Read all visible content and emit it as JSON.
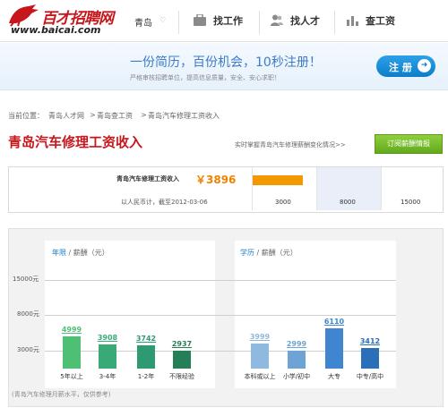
{
  "header": {
    "logo_text": "百才招聘网",
    "logo_url": "www.baicai.com",
    "city": "青岛",
    "nav": [
      {
        "label": "找工作",
        "icon": "briefcase-icon"
      },
      {
        "label": "找人才",
        "icon": "people-icon"
      },
      {
        "label": "查工资",
        "icon": "bar-chart-icon"
      }
    ]
  },
  "banner": {
    "headline": "一份简历，百份机会，10秒注册！",
    "subline": "严格审核招聘单位，提高信息质量，安全、安心求职！",
    "register_label": "注 册"
  },
  "breadcrumb": {
    "prefix": "当前位置：",
    "items": [
      "青岛人才网",
      "青岛查工资",
      "青岛汽车修理工资收入"
    ],
    "sep": ">"
  },
  "page": {
    "title": "青岛汽车修理工资收入",
    "subscribe_hint": "实时掌握青岛汽车修理薪酬变化情况>>",
    "subscribe_label": "订阅薪酬情报"
  },
  "salary": {
    "label": "青岛汽车修理工资收入",
    "value": "￥3896",
    "note": "以人民币计，截至2012-03-06",
    "range_labels": [
      "3000",
      "8000",
      "15000"
    ],
    "range_fill_fraction": 0.78
  },
  "chart_data": [
    {
      "type": "bar",
      "legend": {
        "dim": "年限",
        "sep": "/",
        "metric": "薪酬（元）"
      },
      "categories": [
        "5年以上",
        "3-4年",
        "1-2年",
        "不限经验"
      ],
      "values": [
        4999,
        3908,
        3742,
        2937
      ],
      "value_labels": [
        "4999",
        "3908",
        "3742",
        "2937"
      ],
      "yticks": [
        "15000元",
        "8000元",
        "3000元"
      ],
      "ytick_values": [
        15000,
        8000,
        3000
      ],
      "colors": [
        "#4fbf75",
        "#3aa978",
        "#2e9a71",
        "#247f56"
      ]
    },
    {
      "type": "bar",
      "legend": {
        "dim": "学历",
        "sep": "/",
        "metric": "薪酬（元）"
      },
      "categories": [
        "本科或以上",
        "小学/初中",
        "大专",
        "中专/高中"
      ],
      "values": [
        3999,
        2999,
        6110,
        3412
      ],
      "value_labels": [
        "3999",
        "2999",
        "6110",
        "3412"
      ],
      "colors": [
        "#8fb9df",
        "#6ea3d6",
        "#3f85cf",
        "#2a6fb8"
      ]
    }
  ],
  "chart_footnote": "(青岛汽车修理月薪水平，仅供参考)"
}
